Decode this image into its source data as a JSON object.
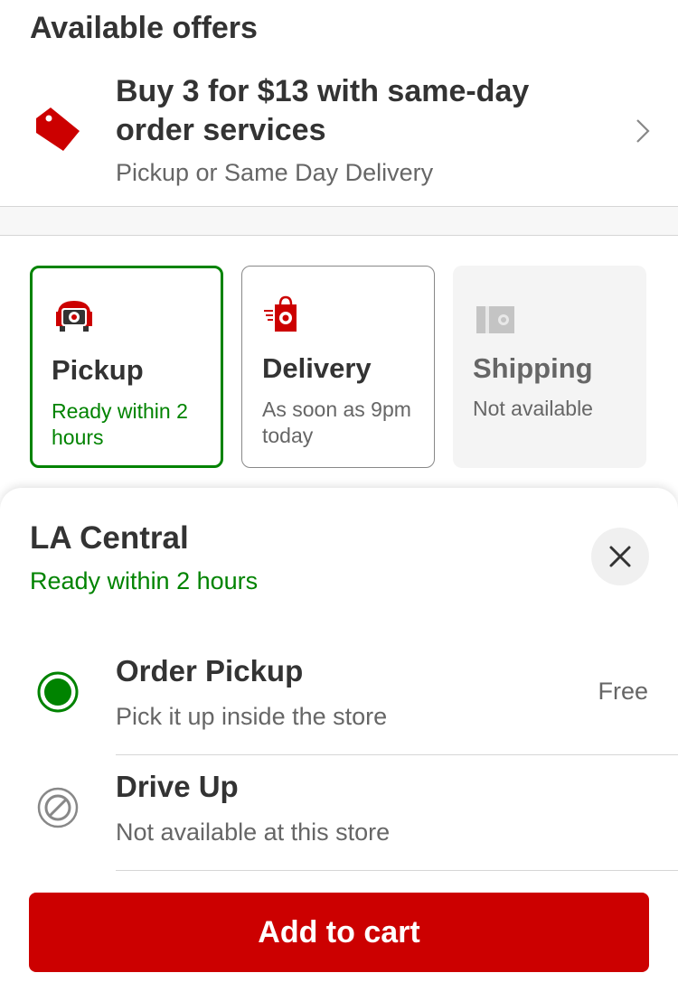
{
  "offers": {
    "title": "Available offers",
    "headline": "Buy 3 for $13 with same-day order services",
    "subtitle": "Pickup or Same Day Delivery",
    "tag_icon": "price-tag-icon",
    "chevron_icon": "chevron-right-icon"
  },
  "fulfillment": [
    {
      "title": "Pickup",
      "subtitle": "Ready within 2 hours",
      "icon": "pickup-car-icon",
      "selected": true
    },
    {
      "title": "Delivery",
      "subtitle": "As soon as 9pm today",
      "icon": "delivery-bag-icon",
      "selected": false
    },
    {
      "title": "Shipping",
      "subtitle": "Not available",
      "icon": "shipping-box-icon",
      "selected": false
    }
  ],
  "sheet": {
    "store_name": "LA Central",
    "ready_text": "Ready within 2 hours",
    "close_icon": "close-icon",
    "options": [
      {
        "title": "Order Pickup",
        "subtitle": "Pick it up inside the store",
        "price": "Free",
        "state": "selected"
      },
      {
        "title": "Drive Up",
        "subtitle": "Not available at this store",
        "price": "",
        "state": "unavailable"
      }
    ],
    "add_to_cart": "Add to cart"
  },
  "colors": {
    "brand_red": "#cc0000",
    "success_green": "#008300",
    "text_dark": "#333333",
    "text_muted": "#666666"
  }
}
